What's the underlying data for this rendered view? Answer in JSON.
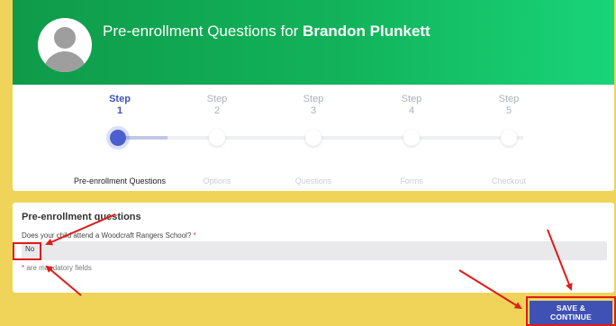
{
  "header": {
    "title_prefix": "Pre-enrollment Questions for ",
    "student_name": "Brandon Plunkett",
    "colors": {
      "gradient_start": "#0f9a4a",
      "gradient_end": "#19d47a"
    }
  },
  "stepper": {
    "steps": [
      {
        "label": "Step",
        "number": "1",
        "name": "Pre-enrollment Questions",
        "active": true
      },
      {
        "label": "Step",
        "number": "2",
        "name": "Options",
        "active": false
      },
      {
        "label": "Step",
        "number": "3",
        "name": "Questions",
        "active": false
      },
      {
        "label": "Step",
        "number": "4",
        "name": "Forms",
        "active": false
      },
      {
        "label": "Step",
        "number": "5",
        "name": "Checkout",
        "active": false
      }
    ],
    "accent_color": "#3f51b5"
  },
  "questions": {
    "title": "Pre-enrollment questions",
    "question_label": "Does your child attend a Woodcraft Rangers School?",
    "required_marker": "*",
    "answer_value": "No",
    "mandatory_note": "are mandatory fields"
  },
  "actions": {
    "save_label": "SAVE & CONTINUE"
  },
  "annotation_color": "#e01b1b"
}
